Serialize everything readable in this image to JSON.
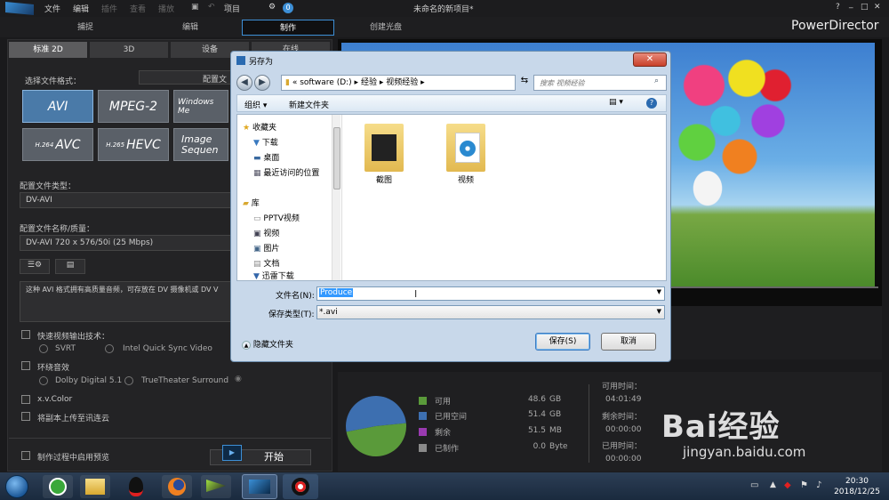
{
  "app": {
    "name": "PowerDirector",
    "project_title": "未命名的新项目*",
    "menu": [
      "文件",
      "编辑",
      "插件",
      "查看",
      "播放",
      "项目"
    ],
    "window_controls": [
      "?",
      "_",
      "□",
      "✕"
    ]
  },
  "modes": [
    "捕捉",
    "编辑",
    "制作",
    "创建光盘"
  ],
  "subtabs": [
    "标准 2D",
    "3D",
    "设备",
    "在线"
  ],
  "left": {
    "choose_format": "选择文件格式：",
    "config_btn": "配置文",
    "formats": [
      {
        "label": "AVI"
      },
      {
        "label": "MPEG-2"
      },
      {
        "label": "Windows Me"
      },
      {
        "sup": "H.264",
        "label": "AVC"
      },
      {
        "sup": "H.265",
        "label": "HEVC"
      },
      {
        "label": "Image Sequen"
      }
    ],
    "profile_type_label": "配置文件类型：",
    "profile_type": "DV-AVI",
    "profile_name_label": "配置文件名称/质量：",
    "profile_name": "DV-AVI 720 x 576/50i (25 Mbps)",
    "description": "这种 AVI 格式拥有高质量音频，可存放在 DV 摄像机或 DV V",
    "fast_render": "快速视频输出技术：",
    "svrt": "SVRT",
    "intel": "Intel Quick Sync Video",
    "surround": "环绕音效",
    "dolby": "Dolby Digital 5.1",
    "truetheater": "TrueTheater Surround",
    "xvcolor": "x.v.Color",
    "upload": "将副本上传至讯连云",
    "preview_during": "制作过程中启用预览",
    "start": "开始"
  },
  "stats": {
    "legend": [
      {
        "label": "可用",
        "value": "48.6",
        "unit": "GB",
        "color": "#5a9a3a"
      },
      {
        "label": "已用空间",
        "value": "51.4",
        "unit": "GB",
        "color": "#3d6fb0"
      },
      {
        "label": "剩余",
        "value": "51.5",
        "unit": "MB",
        "color": "#9a3ab0"
      },
      {
        "label": "已制作",
        "value": "0.0",
        "unit": "Byte",
        "color": "#8a8a8a"
      }
    ],
    "pie": {
      "available": 48.6,
      "used": 51.4
    },
    "times": [
      {
        "label": "可用时间：",
        "value": "04:01:49"
      },
      {
        "label": "剩余时间：",
        "value": "00:00:00"
      },
      {
        "label": "已用时间：",
        "value": "00:00:00"
      }
    ]
  },
  "dialog": {
    "title": "另存为",
    "path": [
      "software (D:)",
      "经验",
      "视频经验"
    ],
    "search_placeholder": "搜索 视频经验",
    "organize": "组织 ▾",
    "new_folder": "新建文件夹",
    "nav": {
      "favorites": "收藏夹",
      "fav_items": [
        "下载",
        "桌面",
        "最近访问的位置"
      ],
      "library": "库",
      "lib_items": [
        "PPTV视频",
        "视频",
        "图片",
        "文档",
        "迅雷下载"
      ]
    },
    "files": [
      "截图",
      "视频"
    ],
    "filename_label": "文件名(N):",
    "filename": "Produce",
    "filetype_label": "保存类型(T):",
    "filetype": "*.avi",
    "hide_folders": "隐藏文件夹",
    "save": "保存(S)",
    "cancel": "取消"
  },
  "taskbar": {
    "time": "20:30",
    "date": "2018/12/25"
  },
  "watermark": {
    "text": "Bai经验",
    "url": "jingyan.baidu.com"
  }
}
